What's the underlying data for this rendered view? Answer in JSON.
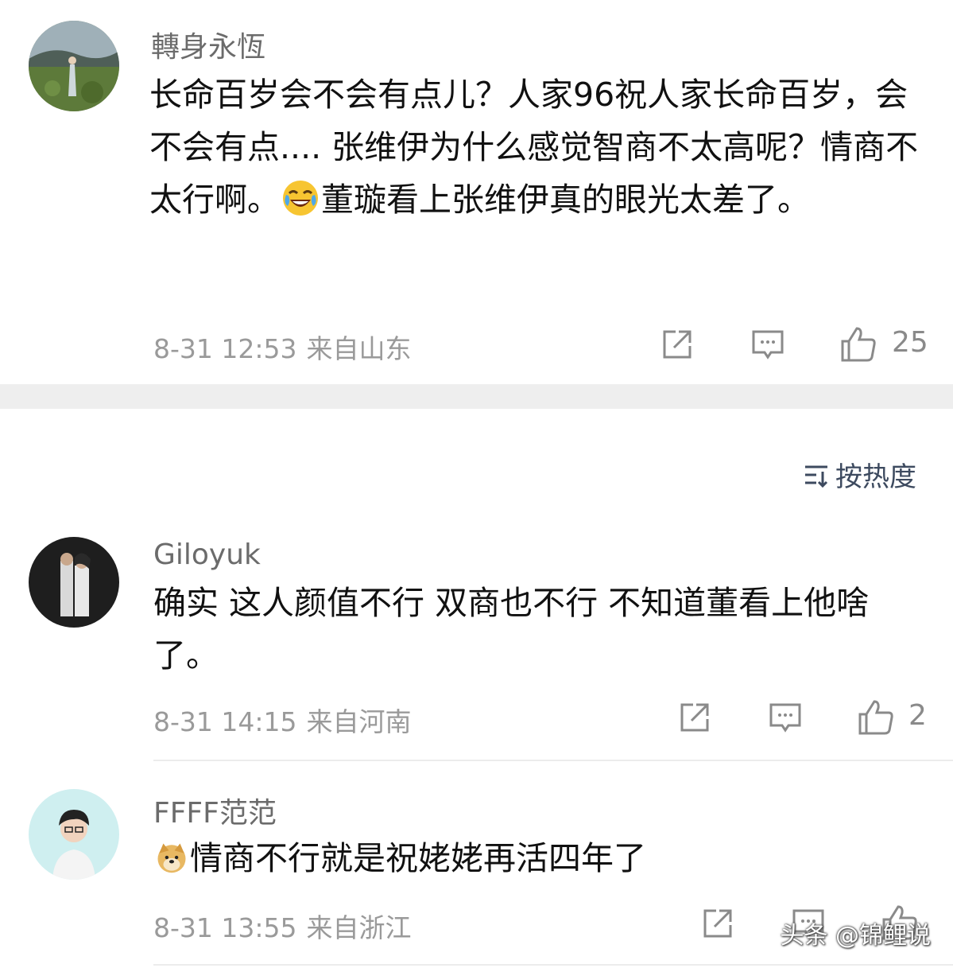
{
  "comments": [
    {
      "username": "轉身永恆",
      "text_before_emoji": "长命百岁会不会有点儿？人家96祝人家长命百岁，会不会有点.... 张维伊为什么感觉智商不太高呢？情商不太行啊。",
      "emoji": "laughing-tears-emoji",
      "text_after_emoji": "董璇看上张维伊真的眼光太差了。",
      "time": "8-31 12:53",
      "location": "来自山东",
      "likes": "25"
    },
    {
      "username": "Giloyuk",
      "text": "确实 这人颜值不行 双商也不行 不知道董看上他啥了。",
      "time": "8-31 14:15",
      "location": "来自河南",
      "likes": "2"
    },
    {
      "username": "FFFF范范",
      "emoji": "doge-emoji",
      "text": "情商不行就是祝姥姥再活四年了",
      "time": "8-31 13:55",
      "location": "来自浙江"
    }
  ],
  "sort": {
    "label": "按热度",
    "icon": "sort-icon"
  },
  "watermark": "头条 @锦鲤说",
  "colors": {
    "background": "#ffffff",
    "divider": "#eeeeee",
    "meta_text": "#9a9a9a",
    "sort_text": "#3d4a5f"
  }
}
